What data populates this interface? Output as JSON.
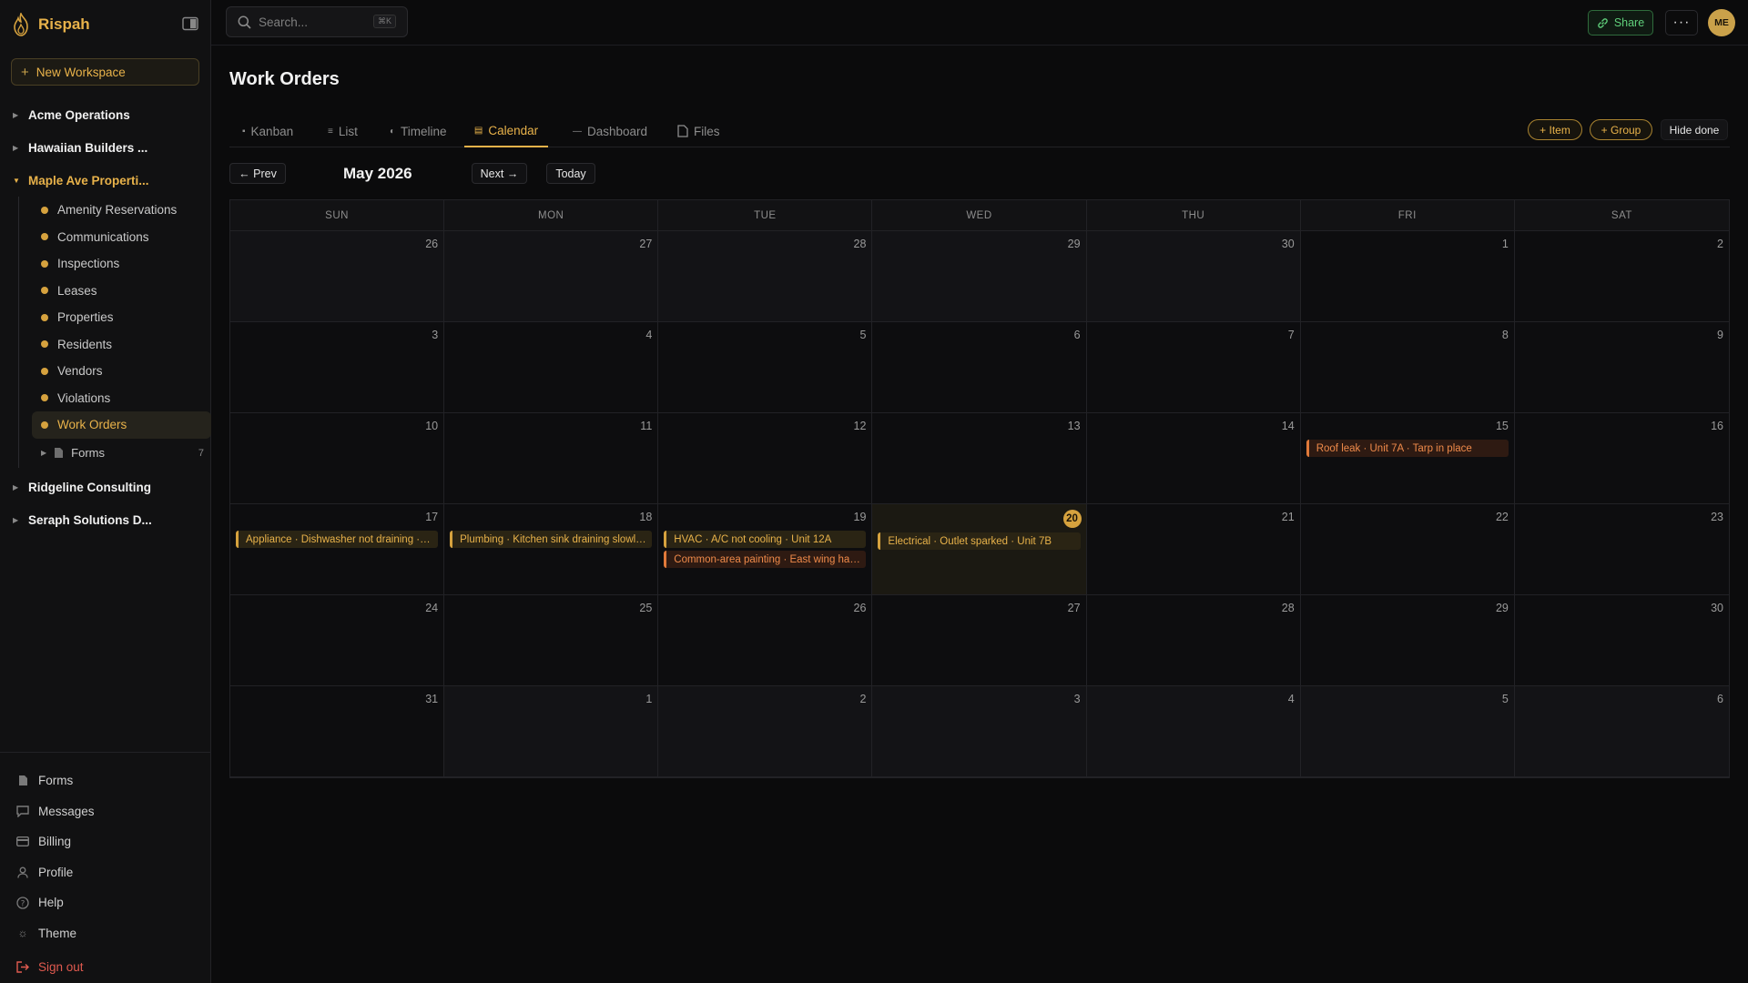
{
  "app": {
    "name": "Rispah"
  },
  "sidebar": {
    "new_workspace": "New Workspace",
    "workspaces": [
      {
        "label": "Acme Operations",
        "open": false
      },
      {
        "label": "Hawaiian Builders ...",
        "open": false
      },
      {
        "label": "Maple Ave Properti...",
        "open": true
      },
      {
        "label": "Ridgeline Consulting",
        "open": false
      },
      {
        "label": "Seraph Solutions D...",
        "open": false
      }
    ],
    "sub_items": [
      "Amenity Reservations",
      "Communications",
      "Inspections",
      "Leases",
      "Properties",
      "Residents",
      "Vendors",
      "Violations",
      "Work Orders"
    ],
    "active_sub_item": "Work Orders",
    "forms_folder": {
      "label": "Forms",
      "count": "7"
    },
    "bottom": {
      "forms": "Forms",
      "messages": "Messages",
      "billing": "Billing",
      "profile": "Profile",
      "help": "Help",
      "theme": "Theme",
      "sign_out": "Sign out"
    }
  },
  "topbar": {
    "search_placeholder": "Search...",
    "search_shortcut": "⌘K",
    "share": "Share",
    "more": "···",
    "avatar_initials": "ME"
  },
  "page": {
    "title": "Work Orders"
  },
  "tabs": {
    "kanban": "Kanban",
    "list": "List",
    "timeline": "Timeline",
    "calendar": "Calendar",
    "dashboard": "Dashboard",
    "files": "Files",
    "active": "Calendar",
    "add_item": "+ Item",
    "add_group": "+ Group",
    "hide_done": "Hide done"
  },
  "calendar": {
    "prev": "← Prev",
    "next": "Next →",
    "today": "Today",
    "month_label": "May 2026",
    "weekdays": [
      "SUN",
      "MON",
      "TUE",
      "WED",
      "THU",
      "FRI",
      "SAT"
    ],
    "today_date": "20",
    "weeks": [
      [
        {
          "d": "26",
          "out": true
        },
        {
          "d": "27",
          "out": true
        },
        {
          "d": "28",
          "out": true
        },
        {
          "d": "29",
          "out": true
        },
        {
          "d": "30",
          "out": true
        },
        {
          "d": "1"
        },
        {
          "d": "2"
        }
      ],
      [
        {
          "d": "3"
        },
        {
          "d": "4"
        },
        {
          "d": "5"
        },
        {
          "d": "6"
        },
        {
          "d": "7"
        },
        {
          "d": "8"
        },
        {
          "d": "9"
        }
      ],
      [
        {
          "d": "10"
        },
        {
          "d": "11"
        },
        {
          "d": "12"
        },
        {
          "d": "13"
        },
        {
          "d": "14"
        },
        {
          "d": "15",
          "events": [
            {
              "text": "Roof leak · Unit 7A · Tarp in place",
              "color": "orange"
            }
          ]
        },
        {
          "d": "16"
        }
      ],
      [
        {
          "d": "17",
          "events": [
            {
              "text": "Appliance · Dishwasher not draining · …",
              "color": "gold"
            }
          ]
        },
        {
          "d": "18",
          "events": [
            {
              "text": "Plumbing · Kitchen sink draining slowl…",
              "color": "gold"
            }
          ]
        },
        {
          "d": "19",
          "events": [
            {
              "text": "HVAC · A/C not cooling · Unit 12A",
              "color": "gold"
            },
            {
              "text": "Common-area painting · East wing ha…",
              "color": "orange"
            }
          ]
        },
        {
          "d": "20",
          "today": true,
          "events": [
            {
              "text": "Electrical · Outlet sparked · Unit 7B",
              "color": "gold"
            }
          ]
        },
        {
          "d": "21"
        },
        {
          "d": "22"
        },
        {
          "d": "23"
        }
      ],
      [
        {
          "d": "24"
        },
        {
          "d": "25"
        },
        {
          "d": "26"
        },
        {
          "d": "27"
        },
        {
          "d": "28"
        },
        {
          "d": "29"
        },
        {
          "d": "30"
        }
      ],
      [
        {
          "d": "31"
        },
        {
          "d": "1",
          "out": true
        },
        {
          "d": "2",
          "out": true
        },
        {
          "d": "3",
          "out": true
        },
        {
          "d": "4",
          "out": true
        },
        {
          "d": "5",
          "out": true
        },
        {
          "d": "6",
          "out": true
        }
      ]
    ]
  },
  "colors": {
    "accent": "#e8b24a",
    "success": "#5fcf7a",
    "danger": "#e05a4f",
    "event_orange": "#e07a3a"
  }
}
